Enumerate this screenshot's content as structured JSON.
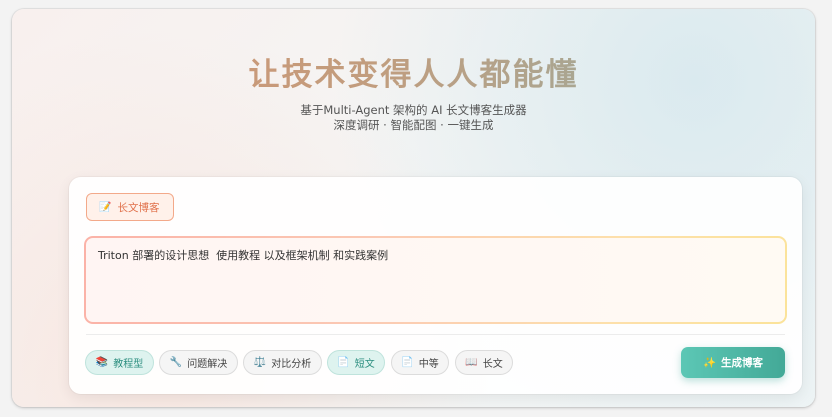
{
  "hero": {
    "title": "让技术变得人人都能懂",
    "subtitle_line1": "基于Multi-Agent 架构的 AI 长文博客生成器",
    "subtitle_line2": "深度调研 · 智能配图 · 一键生成"
  },
  "mode_tab": {
    "icon": "📝",
    "label": "长文博客"
  },
  "input": {
    "value": "Triton 部署的设计思想  使用教程 以及框架机制 和实践案例"
  },
  "style_options": [
    {
      "icon": "📚",
      "label": "教程型",
      "active": true
    },
    {
      "icon": "🔧",
      "label": "问题解决",
      "active": false
    },
    {
      "icon": "⚖️",
      "label": "对比分析",
      "active": false
    }
  ],
  "length_options": [
    {
      "icon": "📄",
      "label": "短文",
      "active": true
    },
    {
      "icon": "📄",
      "label": "中等",
      "active": false
    },
    {
      "icon": "📖",
      "label": "长文",
      "active": false
    }
  ],
  "generate_button": {
    "icon": "✨",
    "label": "生成博客"
  }
}
